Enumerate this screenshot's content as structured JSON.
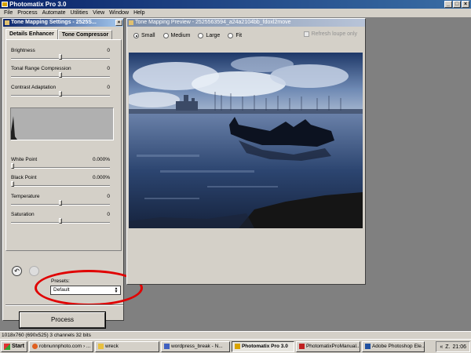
{
  "app": {
    "title": "Photomatix Pro 3.0"
  },
  "menu": [
    "File",
    "Process",
    "Automate",
    "Utilities",
    "View",
    "Window",
    "Help"
  ],
  "settings": {
    "title": "Tone Mapping Settings - 2525S...",
    "tabs": [
      "Details Enhancer",
      "Tone Compressor"
    ],
    "sliders": [
      {
        "label": "Brightness",
        "value": "0",
        "level": 0.5
      },
      {
        "label": "Tonal Range Compression",
        "value": "0",
        "level": 0.5
      },
      {
        "label": "Contrast Adaptation",
        "value": "0",
        "level": 0.5
      },
      {
        "label": "White Point",
        "value": "0.000%",
        "level": 0.0
      },
      {
        "label": "Black Point",
        "value": "0.000%",
        "level": 0.0
      },
      {
        "label": "Temperature",
        "value": "0",
        "level": 0.5
      },
      {
        "label": "Saturation",
        "value": "0",
        "level": 0.5
      }
    ],
    "presets_label": "Presets:",
    "presets_value": "Default",
    "process_label": "Process"
  },
  "preview": {
    "title": "Tone Mapping Preview - 2525563594_a24a2104bb_fdoxl2move",
    "sizes": [
      "Small",
      "Medium",
      "Large",
      "Fit"
    ],
    "selected_size": "Small",
    "refresh_label": "Refresh loupe only"
  },
  "status": {
    "text": "1018x760 (690x525) 3 channels 32 bits"
  },
  "taskbar": {
    "start": "Start",
    "tasks": [
      {
        "label": "robnunnphoto.com › ...",
        "active": false
      },
      {
        "label": "wreck",
        "active": false
      },
      {
        "label": "wordpress_break - N...",
        "active": false
      },
      {
        "label": "Photomatix Pro 3.0",
        "active": true
      },
      {
        "label": "PhotomatixProManual...",
        "active": false
      },
      {
        "label": "Adobe Photoshop Ele...",
        "active": false
      }
    ],
    "tray_lang": "Z.",
    "clock": "21:06"
  },
  "colors": {
    "title_active": "#0a246a",
    "highlight_ellipse": "#e00000",
    "chrome": "#d4d0c8"
  }
}
